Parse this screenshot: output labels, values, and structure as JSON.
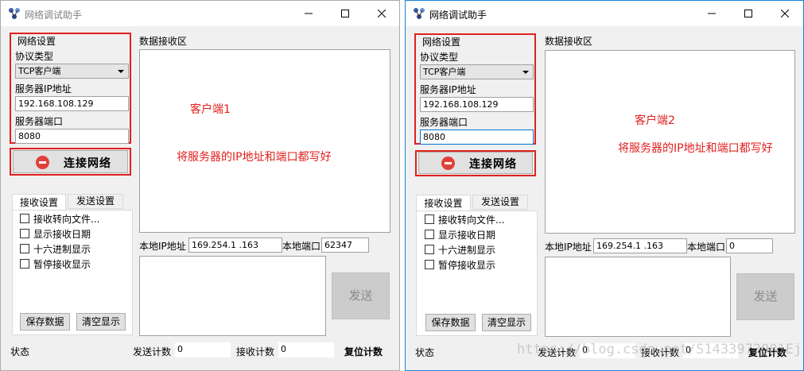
{
  "windows": [
    {
      "title": "网络调试助手",
      "net_settings": {
        "group_label": "网络设置",
        "protocol_label": "协议类型",
        "protocol_value": "TCP客户端",
        "server_ip_label": "服务器IP地址",
        "server_ip": "192.168.108.129",
        "server_port_label": "服务器端口",
        "server_port": "8080"
      },
      "connect_label": "连接网络",
      "recv_area_label": "数据接收区",
      "tabs": [
        "接收设置",
        "发送设置"
      ],
      "options": [
        "接收转向文件...",
        "显示接收日期",
        "十六进制显示",
        "暂停接收显示"
      ],
      "save_label": "保存数据",
      "clear_label": "清空显示",
      "local_ip_label": "本地IP地址",
      "local_ip": "169.254.1  .163",
      "local_port_label": "本地端口",
      "local_port": "62347",
      "send_label": "发送",
      "status_label": "状态",
      "send_count_label": "发送计数",
      "send_count": "0",
      "recv_count_label": "接收计数",
      "recv_count": "0",
      "reset_label": "复位计数",
      "note_title": "客户端1",
      "note_body": "将服务器的IP地址和端口都写好"
    },
    {
      "title": "网络调试助手",
      "net_settings": {
        "group_label": "网络设置",
        "protocol_label": "协议类型",
        "protocol_value": "TCP客户端",
        "server_ip_label": "服务器IP地址",
        "server_ip": "192.168.108.129",
        "server_port_label": "服务器端口",
        "server_port": "8080"
      },
      "connect_label": "连接网络",
      "recv_area_label": "数据接收区",
      "tabs": [
        "接收设置",
        "发送设置"
      ],
      "options": [
        "接收转向文件...",
        "显示接收日期",
        "十六进制显示",
        "暂停接收显示"
      ],
      "save_label": "保存数据",
      "clear_label": "清空显示",
      "local_ip_label": "本地IP地址",
      "local_ip": "169.254.1  .163",
      "local_port_label": "本地端口",
      "local_port": "0",
      "send_label": "发送",
      "status_label": "状态",
      "send_count_label": "发送计数",
      "send_count": "0",
      "recv_count_label": "接收计数",
      "recv_count": "0",
      "reset_label": "复位计数",
      "note_title": "客户端2",
      "note_body": "将服务器的IP地址和端口都写好"
    }
  ],
  "watermark": "https://blog.csdn.net/S1433972001Ej",
  "colors": {
    "annotation_red": "#e0201e",
    "active_border": "#1883d7",
    "window_bg": "#f0f0f0"
  },
  "icons": {
    "app": "network-app-icon",
    "connect": "red-stop-icon"
  }
}
